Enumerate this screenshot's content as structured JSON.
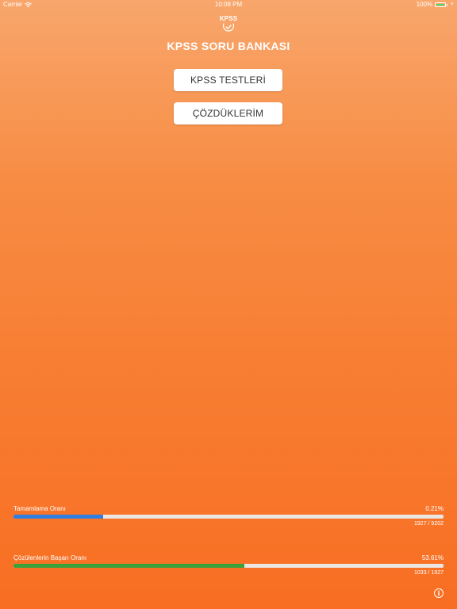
{
  "status_bar": {
    "carrier": "Carrier",
    "time": "10:08 PM",
    "battery": "100%",
    "icons": [
      "wifi-icon",
      "battery-icon",
      "charging-icon"
    ]
  },
  "header": {
    "logo_text": "KPSS",
    "logo_icon": "check-circle-icon",
    "title": "KPSS SORU BANKASI"
  },
  "menu": {
    "tests_label": "KPSS TESTLERİ",
    "solved_label": "ÇÖZDÜKLERİM"
  },
  "stats": {
    "completion": {
      "label": "Tamamlama Oranı",
      "percent_text": "0.21%",
      "count_text": "1927 / 9202",
      "progress": 0.2094,
      "color": "#2f7fe0"
    },
    "success": {
      "label": "Çözülenlerin Başarı Oranı",
      "percent_text": "53.61%",
      "count_text": "1033 / 1927",
      "progress": 0.5361,
      "color": "#3aa23a"
    }
  },
  "footer": {
    "info_icon": "info-icon",
    "info_symbol": "i"
  },
  "colors": {
    "background_top": "#f8a66c",
    "background_bottom": "#f86e22",
    "button_bg": "#ffffff",
    "button_text": "#333333",
    "track": "#ece6e2"
  }
}
